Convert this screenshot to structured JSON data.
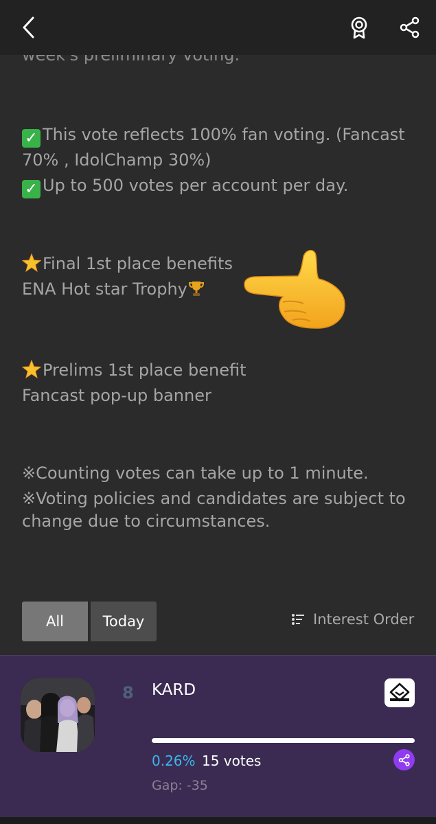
{
  "header": {
    "back_icon": "chevron-left-icon",
    "award_icon": "award-badge-icon",
    "share_icon": "share-icon"
  },
  "content": {
    "clipped_line": "week's preliminary voting.",
    "rules": [
      "This vote reflects 100% fan voting. (Fancast",
      "70% , IdolChamp 30%)",
      "Up to 500 votes per account per day."
    ],
    "final_title": "Final 1st place benefits",
    "final_benefit": "ENA Hot star Trophy",
    "prelim_title": "Prelims 1st place benefit",
    "prelim_benefit": "Fancast pop-up banner",
    "note_1": "※Counting votes can take up to 1 minute.",
    "note_2_a": "※Voting policies and candidates are subject to",
    "note_2_b": "change due to circumstances."
  },
  "filters": {
    "all_label": "All",
    "today_label": "Today",
    "sort_label": "Interest Order",
    "sort_icon": "list-sort-icon"
  },
  "candidate": {
    "rank": "8",
    "name": "KARD",
    "percent_label": "0.26%",
    "votes_label": "15 votes",
    "gap_label": "Gap: -35",
    "progress_fraction": 1.0,
    "vote_icon": "vote-box-icon",
    "share_icon": "share-icon"
  },
  "colors": {
    "background": "#2b2b2b",
    "card": "#3b2b52",
    "accent_blue": "#3db6ee",
    "accent_purple": "#8f3cf0"
  }
}
